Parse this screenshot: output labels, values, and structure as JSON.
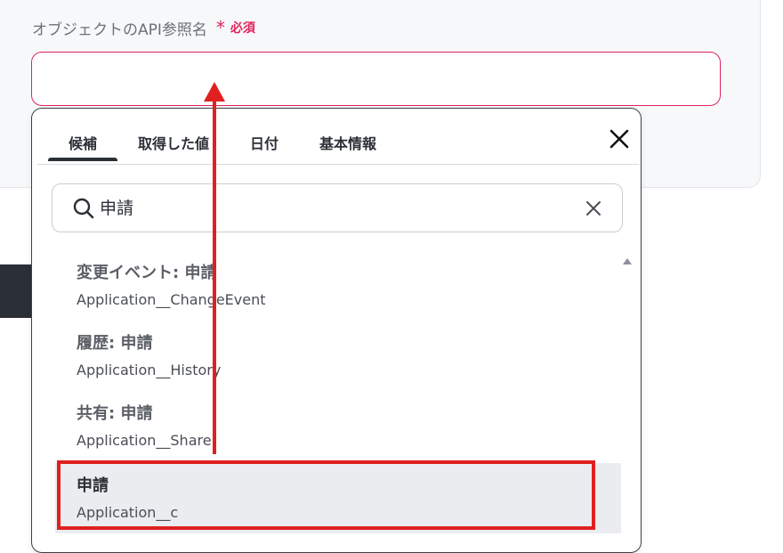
{
  "field": {
    "label": "オブジェクトのAPI参照名",
    "required_star": "*",
    "required_text": "必須",
    "value": ""
  },
  "dropdown": {
    "tabs": [
      {
        "label": "候補",
        "active": true
      },
      {
        "label": "取得した値"
      },
      {
        "label": "日付"
      },
      {
        "label": "基本情報"
      }
    ],
    "search_value": "申請",
    "items": [
      {
        "title": "変更イベント: 申請",
        "api_name": "Application__ChangeEvent"
      },
      {
        "title": "履歴: 申請",
        "api_name": "Application__History"
      },
      {
        "title": "共有: 申請",
        "api_name": "Application__Share"
      },
      {
        "title": "申請",
        "api_name": "Application__c",
        "selected": true
      }
    ]
  },
  "colors": {
    "required": "#e0245e",
    "annotation": "#e02020",
    "selected_bg": "#eaecf0"
  }
}
